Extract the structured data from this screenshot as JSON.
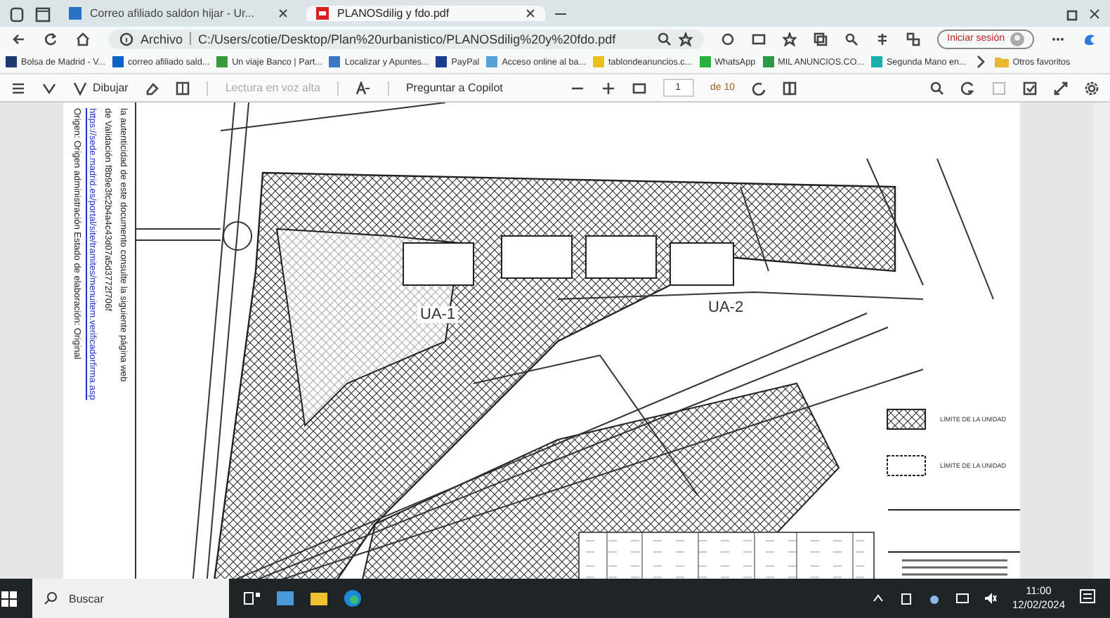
{
  "tabs": [
    {
      "label": "Correo afiliado saldon hijar - Ur...",
      "selected": false
    },
    {
      "label": "PLANOSdilig y fdo.pdf",
      "selected": true
    }
  ],
  "address_bar": {
    "scheme_label": "Archivo",
    "url": "C:/Users/cotie/Desktop/Plan%20urbanistico/PLANOSdilig%20y%20fdo.pdf",
    "sign_in": "Iniciar sesión"
  },
  "bookmarks": [
    {
      "label": "Bolsa de Madrid - V...",
      "color": "#1f3a6e"
    },
    {
      "label": "correo afiliado sald...",
      "color": "#0a64c8"
    },
    {
      "label": "Un viaje Banco | Part...",
      "color": "#3a9a3a"
    },
    {
      "label": "Localizar y Apuntes...",
      "color": "#3c78c8"
    },
    {
      "label": "PayPal",
      "color": "#1a3c8c"
    },
    {
      "label": "Acceso online al ba...",
      "color": "#58a0d8"
    },
    {
      "label": "tablondeanuncios.c...",
      "color": "#e8c020"
    },
    {
      "label": "WhatsApp",
      "color": "#25b040"
    },
    {
      "label": "MIL ANUNCIOS.CO...",
      "color": "#2a9a4a"
    },
    {
      "label": "Segunda Mano en...",
      "color": "#18b0a8"
    }
  ],
  "other_bookmarks": "Otros favoritos",
  "pdf_toolbar": {
    "draw": "Dibujar",
    "read_aloud": {
      "label": "Lectura en voz alta",
      "disabled": true
    },
    "copilot": "Preguntar a Copilot",
    "page": "1",
    "page_count": "de 10"
  },
  "document": {
    "margin_texts": [
      "la autenticidad de este documento consulte la siguiente página web",
      "de Validación   f8b9e3fc2b4a4c43d07a5d3772f706f",
      "Origen: Origen administración    Estado de elaboración: Original"
    ],
    "margin_link": "https://sede.madrid.es/portal/site/tramites/menuitem.verificadorfirma.asp",
    "plan_labels": [
      "UA-1",
      "UA-2"
    ],
    "legend": [
      "LÍMITE DE LA UNIDAD",
      "LÍMITE DE LA UNIDAD"
    ]
  },
  "taskbar": {
    "search": "Buscar",
    "time": "11:00",
    "date": "12/02/2024"
  }
}
